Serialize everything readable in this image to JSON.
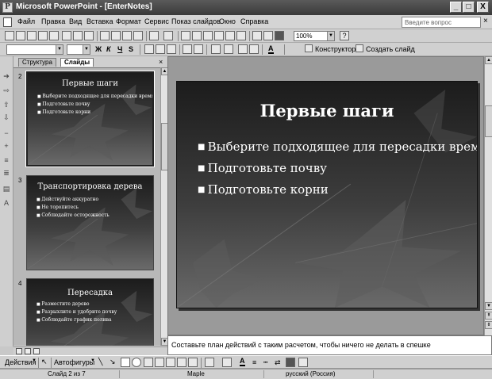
{
  "window": {
    "title": "Microsoft PowerPoint - [EnterNotes]",
    "minimize_glyph": "_",
    "maximize_glyph": "□",
    "close_glyph": "X"
  },
  "menu": {
    "items": [
      "Файл",
      "Правка",
      "Вид",
      "Вставка",
      "Формат",
      "Сервис",
      "Показ слайдов",
      "Окно",
      "Справка"
    ],
    "help_placeholder": "Введите вопрос",
    "doc_close_glyph": "×"
  },
  "toolbar": {
    "zoom_value": "100%",
    "help_glyph": "?",
    "bold_label": "Ж",
    "italic_label": "К",
    "underline_label": "Ч",
    "shadow_label": "S",
    "font_color_label": "A",
    "designer_label": "Конструктор",
    "new_slide_label": "Создать слайд"
  },
  "panes": {
    "tabs": [
      "Структура",
      "Слайды"
    ],
    "close_glyph": "×"
  },
  "slides": [
    {
      "number": "2",
      "title": "Первые шаги",
      "bullets": [
        "Выберите подходящее для пересадки время",
        "Подготовьте почву",
        "Подготовьте корни"
      ]
    },
    {
      "number": "3",
      "title": "Транспортировка дерева",
      "bullets": [
        "Действуйте аккуратно",
        "Не торопитесь",
        "Соблюдайте осторожность"
      ]
    },
    {
      "number": "4",
      "title": "Пересадка",
      "bullets": [
        "Разместите дерево",
        "Разрыхлите и удобрите почву",
        "Соблюдайте график полива"
      ]
    }
  ],
  "current_slide": {
    "title": "Первые шаги",
    "bullets": [
      "Выберите подходящее для пересадки время",
      "Подготовьте почву",
      "Подготовьте корни"
    ]
  },
  "notes": {
    "text": "Составьте план действий с таким расчетом, чтобы ничего не делать в спешке"
  },
  "drawing": {
    "actions_label": "Действия",
    "autoshapes_label": "Автофигуры"
  },
  "status": {
    "slide_info": "Слайд 2 из 7",
    "design_name": "Maple",
    "language": "русский (Россия)"
  }
}
